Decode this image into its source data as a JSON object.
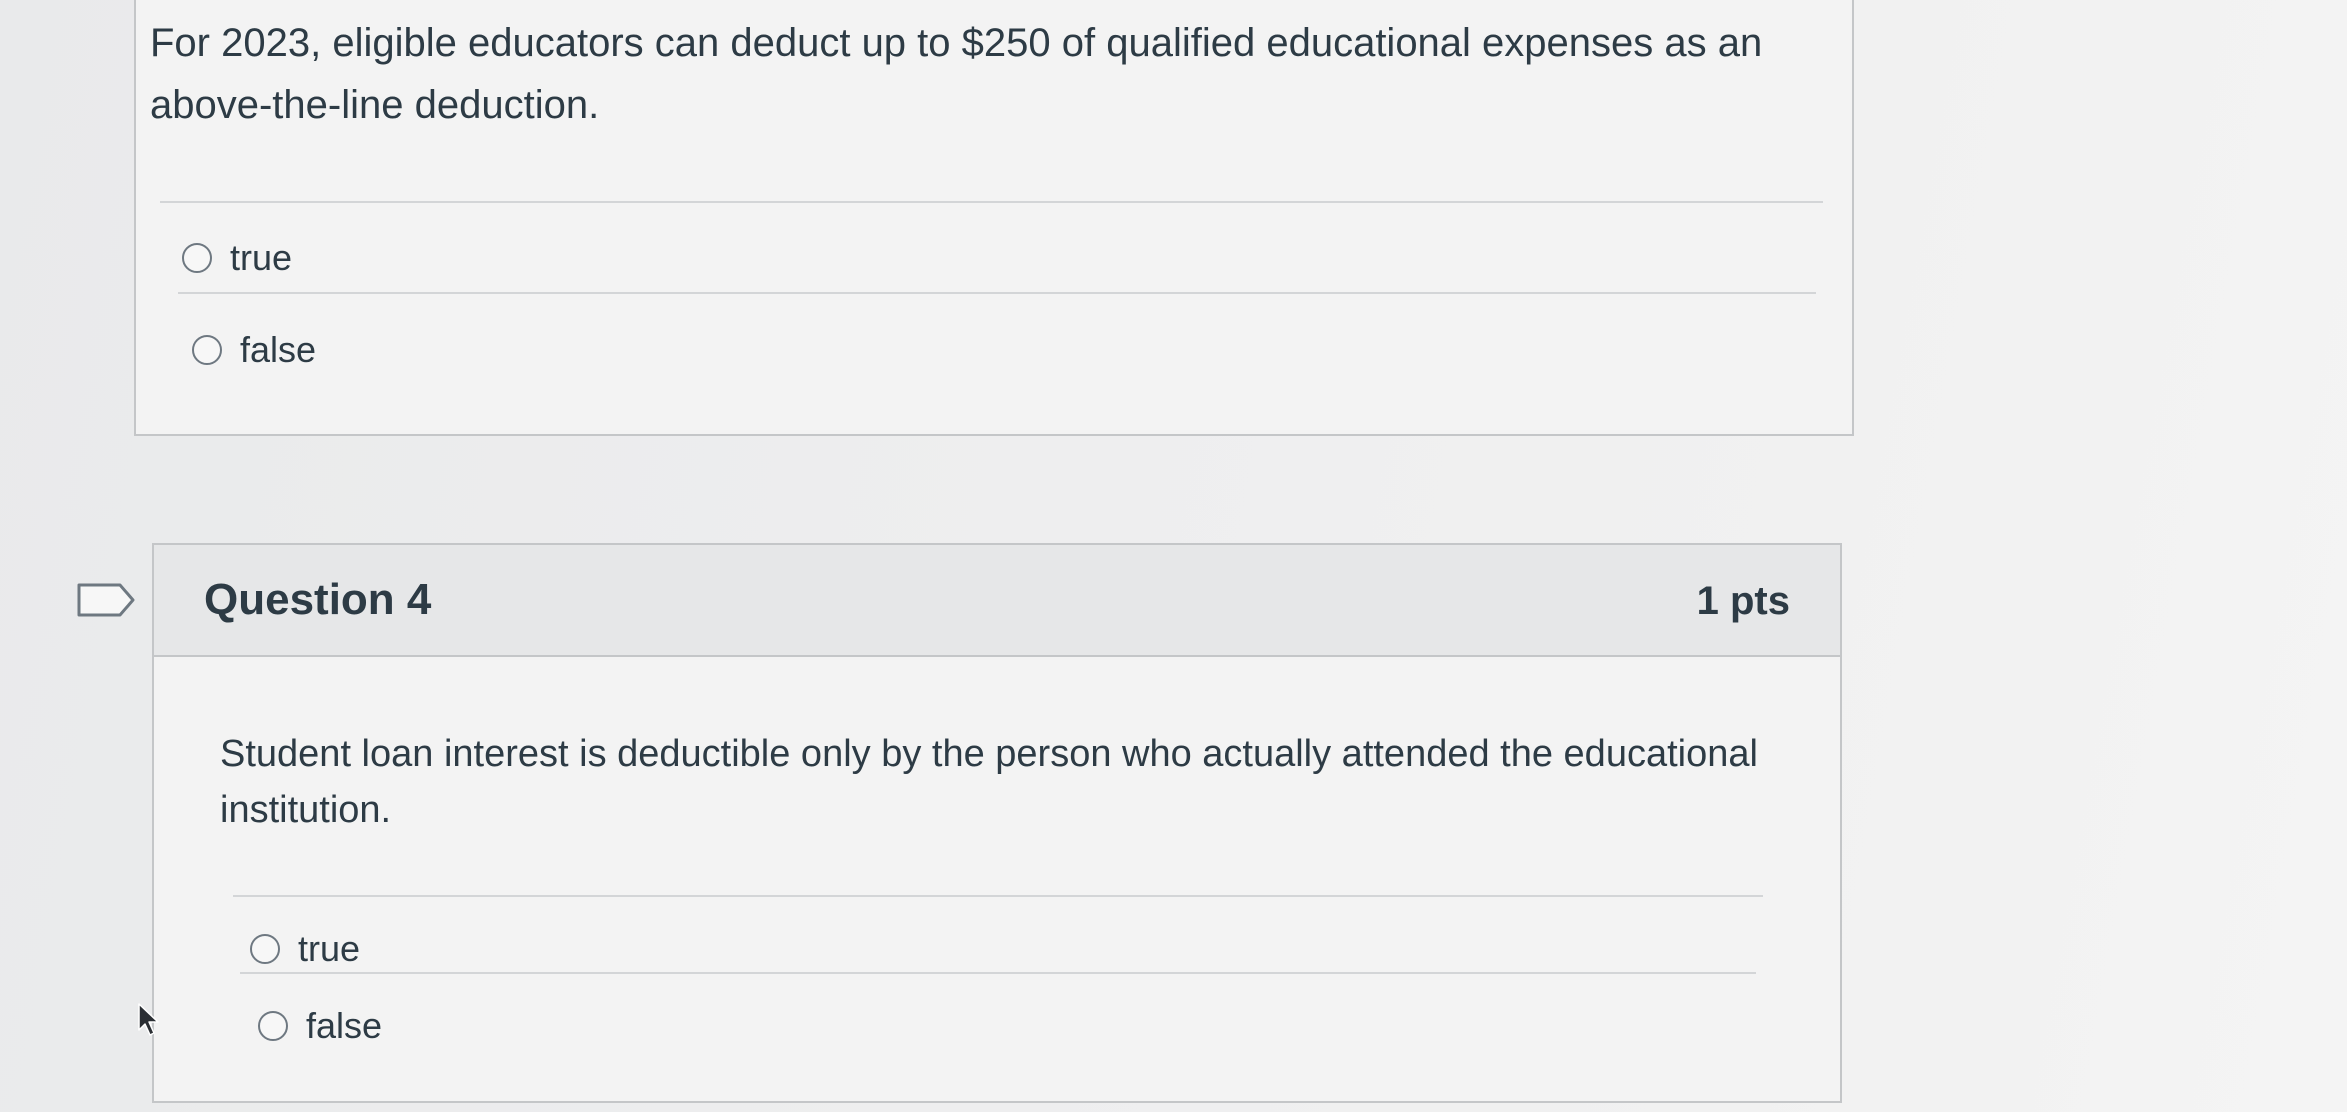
{
  "question3": {
    "text": "For 2023, eligible educators can deduct up to $250 of qualified educational expenses as an above-the-line deduction.",
    "answers": [
      {
        "label": "true"
      },
      {
        "label": "false"
      }
    ]
  },
  "question4": {
    "title": "Question 4",
    "points": "1 pts",
    "text": "Student loan interest is deductible only by the person who actually attended the educational institution.",
    "answers": [
      {
        "label": "true"
      },
      {
        "label": "false"
      }
    ]
  },
  "icons": {
    "flag": "flag-question-icon",
    "radio": "radio-unchecked-icon",
    "cursor": "mouse-pointer-icon"
  }
}
